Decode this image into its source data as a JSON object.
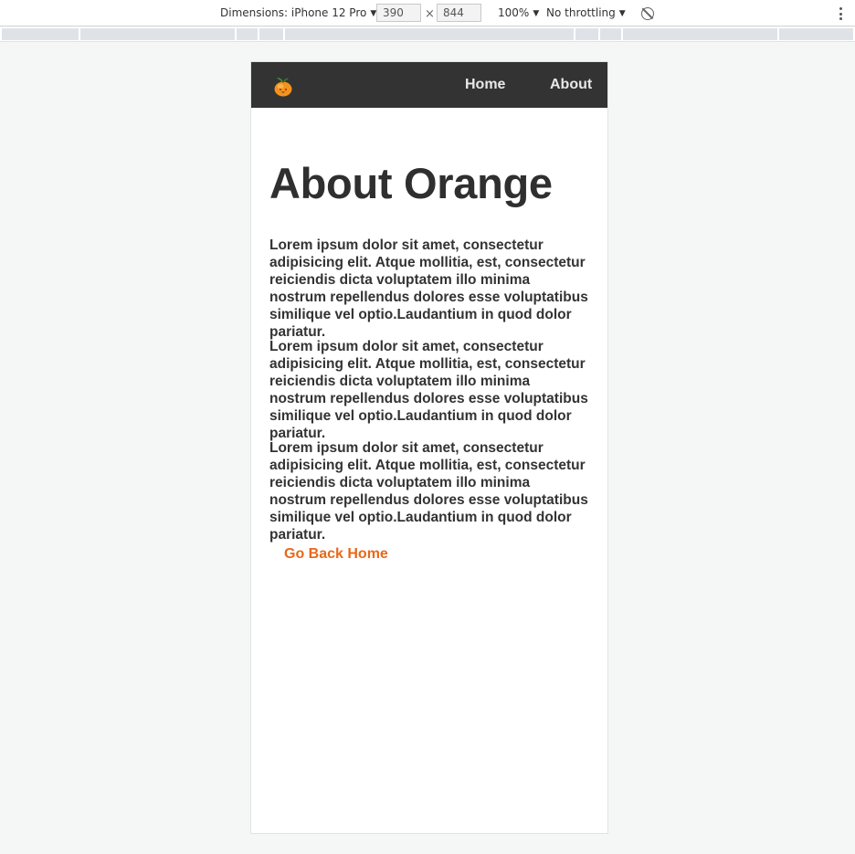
{
  "devtools": {
    "dimensions_label": "Dimensions: iPhone 12 Pro",
    "width_value": "390",
    "height_value": "844",
    "times_symbol": "×",
    "zoom_label": "100%",
    "throttling_label": "No throttling",
    "caret": "▼"
  },
  "navbar": {
    "logo_icon": "orange-fruit-icon",
    "links": [
      {
        "label": "Home"
      },
      {
        "label": "About"
      }
    ]
  },
  "main": {
    "title": "About Orange",
    "paragraphs": [
      "Lorem ipsum dolor sit amet, consectetur adipisicing elit. Atque mollitia, est, consectetur reiciendis dicta voluptatem illo minima nostrum repellendus dolores esse voluptatibus similique vel optio.Laudantium in quod dolor pariatur.",
      "Lorem ipsum dolor sit amet, consectetur adipisicing elit. Atque mollitia, est, consectetur reiciendis dicta voluptatem illo minima nostrum repellendus dolores esse voluptatibus similique vel optio.Laudantium in quod dolor pariatur.",
      "Lorem ipsum dolor sit amet, consectetur adipisicing elit. Atque mollitia, est, consectetur reiciendis dicta voluptatem illo minima nostrum repellendus dolores esse voluptatibus similique vel optio.Laudantium in quod dolor pariatur."
    ],
    "back_link": "Go Back Home"
  },
  "colors": {
    "navbar_bg": "#333333",
    "accent_orange": "#e8681a",
    "text": "#333333",
    "page_bg": "#f5f7f7"
  }
}
